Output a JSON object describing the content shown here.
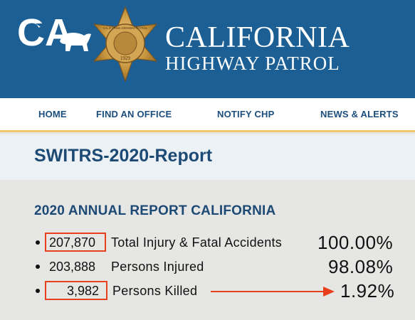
{
  "header": {
    "logo_text": "CA",
    "badge_text": "CALIFORNIA HIGHWAY PATROL",
    "badge_year": "1929",
    "title_line1": "CALIFORNIA",
    "title_line2": "HIGHWAY PATROL"
  },
  "nav": {
    "items": [
      {
        "label": "HOME"
      },
      {
        "label": "FIND AN OFFICE"
      },
      {
        "label": "NOTIFY CHP"
      },
      {
        "label": "NEWS & ALERTS"
      }
    ]
  },
  "page": {
    "title": "SWITRS-2020-Report",
    "section_title": "2020 ANNUAL REPORT CALIFORNIA"
  },
  "stats": [
    {
      "value": "207,870",
      "label": "Total Injury & Fatal Accidents",
      "percent": "100.00%"
    },
    {
      "value": "203,888",
      "label": "Persons Injured",
      "percent": "98.08%"
    },
    {
      "value": "3,982",
      "label": "Persons Killed",
      "percent": "1.92%"
    }
  ],
  "colors": {
    "header_bg": "#1b5f95",
    "nav_text": "#1b4e7d",
    "highlight": "#e8401c",
    "accent_border": "#f1c66e"
  }
}
